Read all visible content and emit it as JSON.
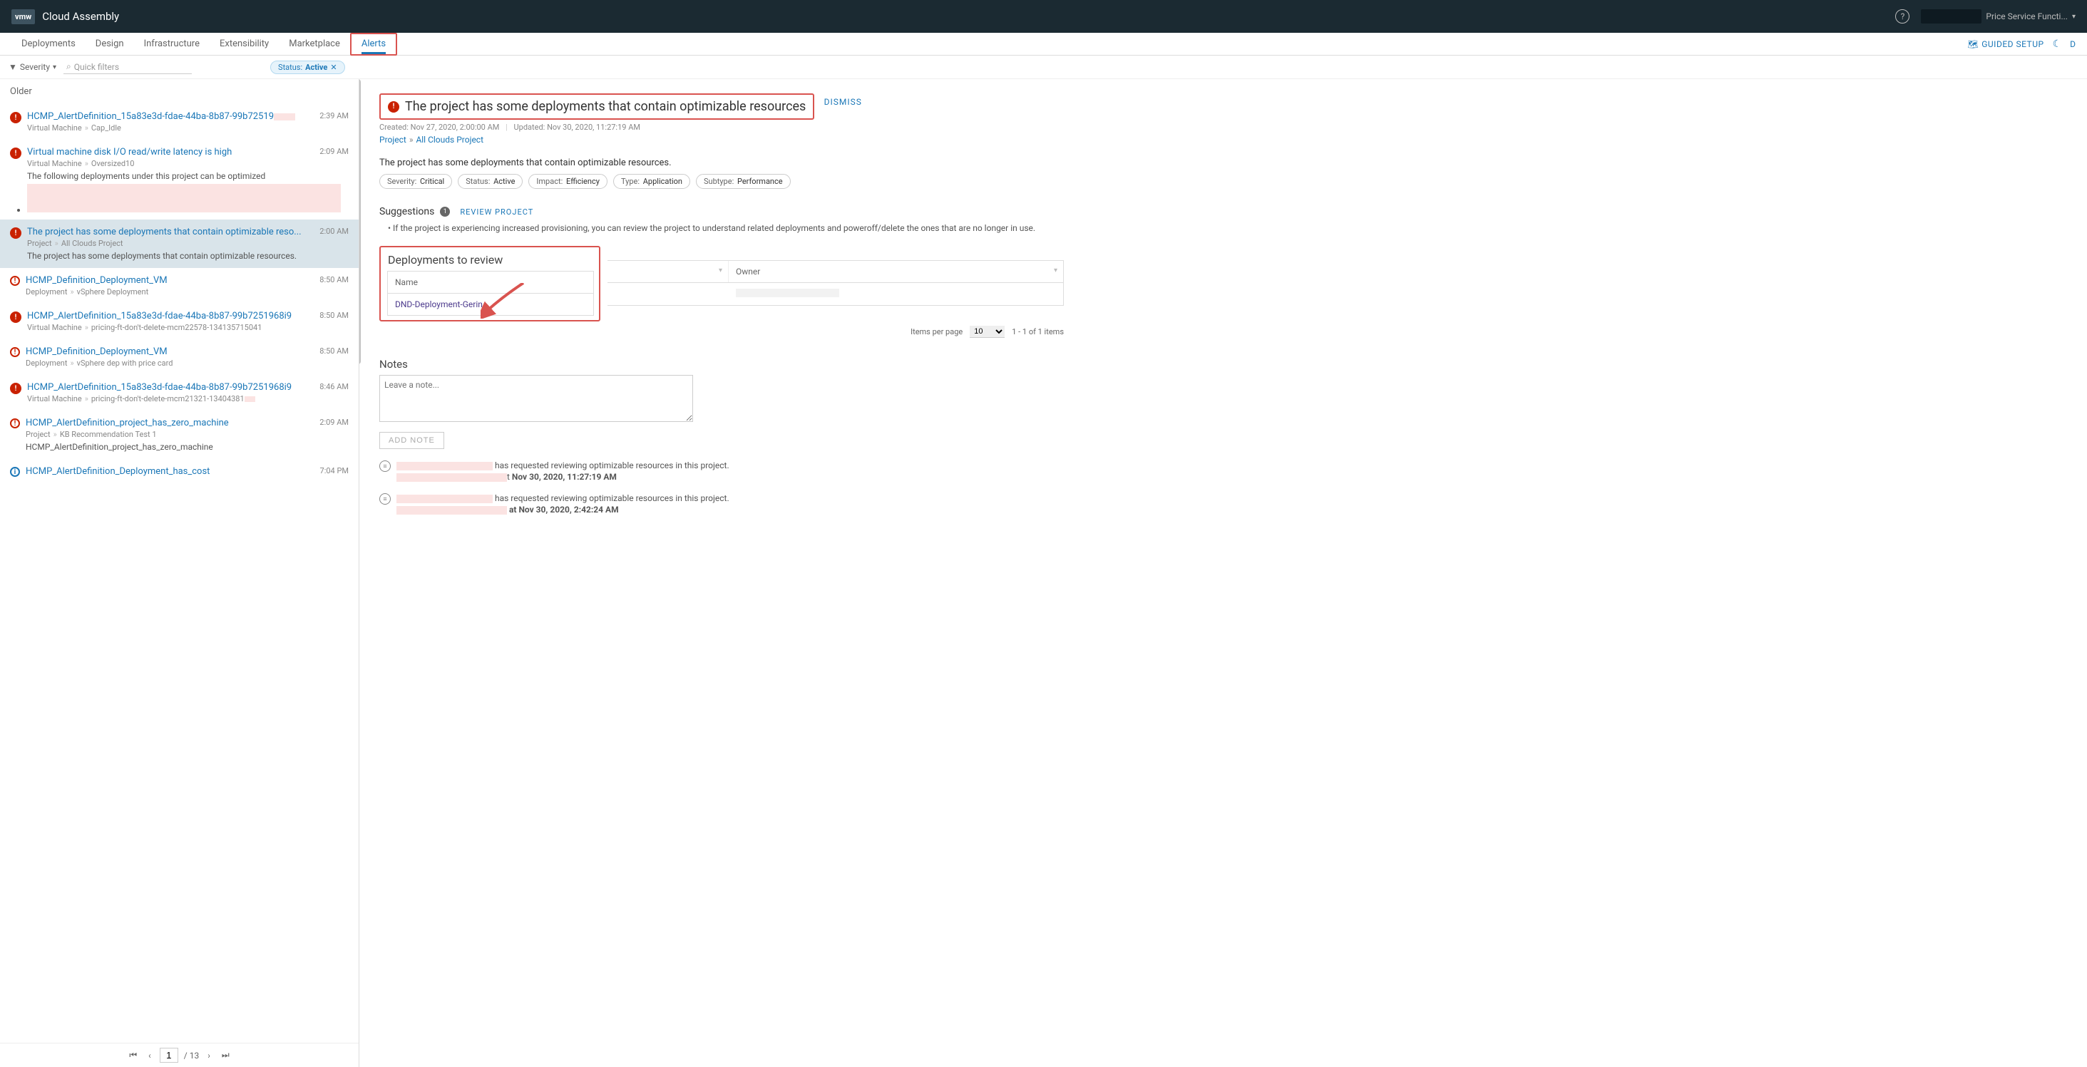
{
  "header": {
    "logo": "vmw",
    "title": "Cloud Assembly",
    "user_label": "Price Service Functi..."
  },
  "nav": {
    "tabs": [
      "Deployments",
      "Design",
      "Infrastructure",
      "Extensibility",
      "Marketplace",
      "Alerts"
    ],
    "guided": "GUIDED SETUP",
    "right_letter": "D"
  },
  "filters": {
    "severity": "Severity",
    "quick": "Quick filters",
    "chip_label": "Status:",
    "chip_value": "Active"
  },
  "left": {
    "older": "Older",
    "items": [
      {
        "sev": "critical",
        "title": "HCMP_AlertDefinition_15a83e3d-fdae-44ba-8b87-99b72519",
        "mask": true,
        "meta1": "Virtual Machine",
        "meta2": "Cap_Idle",
        "time": "2:39 AM"
      },
      {
        "sev": "critical",
        "title": "Virtual machine disk I/O read/write latency is high",
        "meta1": "Virtual Machine",
        "meta2": "Oversized10",
        "desc": "The following deployments under this project can be optimized <ul> <li><a",
        "maskbox": true,
        "time": "2:09 AM"
      },
      {
        "sev": "critical",
        "title": "The project has some deployments that contain optimizable reso...",
        "meta1": "Project",
        "meta2": "All Clouds Project",
        "desc": "The project has some deployments that contain optimizable resources.",
        "time": "2:00 AM",
        "selected": true
      },
      {
        "sev": "warning",
        "title": "HCMP_Definition_Deployment_VM",
        "meta1": "Deployment",
        "meta2": "vSphere Deployment",
        "time": "8:50 AM"
      },
      {
        "sev": "critical",
        "title": "HCMP_AlertDefinition_15a83e3d-fdae-44ba-8b87-99b7251968i9",
        "meta1": "Virtual Machine",
        "meta2": "pricing-ft-don't-delete-mcm22578-134135715041",
        "time": "8:50 AM"
      },
      {
        "sev": "warning",
        "title": "HCMP_Definition_Deployment_VM",
        "meta1": "Deployment",
        "meta2": "vSphere dep with price card",
        "time": "8:50 AM"
      },
      {
        "sev": "critical",
        "title": "HCMP_AlertDefinition_15a83e3d-fdae-44ba-8b87-99b7251968i9",
        "meta1": "Virtual Machine",
        "meta2": "pricing-ft-don't-delete-mcm21321-13404381",
        "metahasmask": true,
        "time": "8:46 AM"
      },
      {
        "sev": "warning",
        "title": "HCMP_AlertDefinition_project_has_zero_machine",
        "meta1": "Project",
        "meta2": "KB Recommendation Test 1",
        "desc": "HCMP_AlertDefinition_project_has_zero_machine",
        "time": "2:09 AM"
      },
      {
        "sev": "info",
        "title": "HCMP_AlertDefinition_Deployment_has_cost",
        "time": "7:04 PM"
      }
    ],
    "page_cur": "1",
    "page_total": "/ 13"
  },
  "detail": {
    "title": "The project has some deployments that contain optimizable resources",
    "dismiss": "DISMISS",
    "created_label": "Created:",
    "created": "Nov 27, 2020, 2:00:00 AM",
    "updated_label": "Updated:",
    "updated": "Nov 30, 2020, 11:27:19 AM",
    "bc1": "Project",
    "bc2": "All Clouds Project",
    "summary": "The project has some deployments that contain optimizable resources.",
    "chips": [
      {
        "k": "Severity:",
        "v": "Critical"
      },
      {
        "k": "Status:",
        "v": "Active"
      },
      {
        "k": "Impact:",
        "v": "Efficiency"
      },
      {
        "k": "Type:",
        "v": "Application"
      },
      {
        "k": "Subtype:",
        "v": "Performance"
      }
    ],
    "sugg_h": "Suggestions",
    "sugg_count": "1",
    "review": "REVIEW PROJECT",
    "sugg_text": "• If the project is experiencing increased provisioning, you can review the project to understand related deployments and poweroff/delete the ones that are no longer in use.",
    "deploy_h": "Deployments to review",
    "col_name": "Name",
    "col_owner": "Owner",
    "row_name": "DND-Deployment-Gerin",
    "pager_label": "Items per page",
    "pager_size": "10",
    "pager_range": "1 - 1 of 1 items",
    "notes_h": "Notes",
    "note_ph": "Leave a note...",
    "add_note": "ADD NOTE",
    "note1_text": "has requested reviewing optimizable resources in this project.",
    "note1_at": "t ",
    "note1_date": "Nov 30, 2020, 11:27:19 AM",
    "note2_text": "has requested reviewing optimizable resources in this project.",
    "note2_date": "at Nov 30, 2020, 2:42:24 AM"
  }
}
